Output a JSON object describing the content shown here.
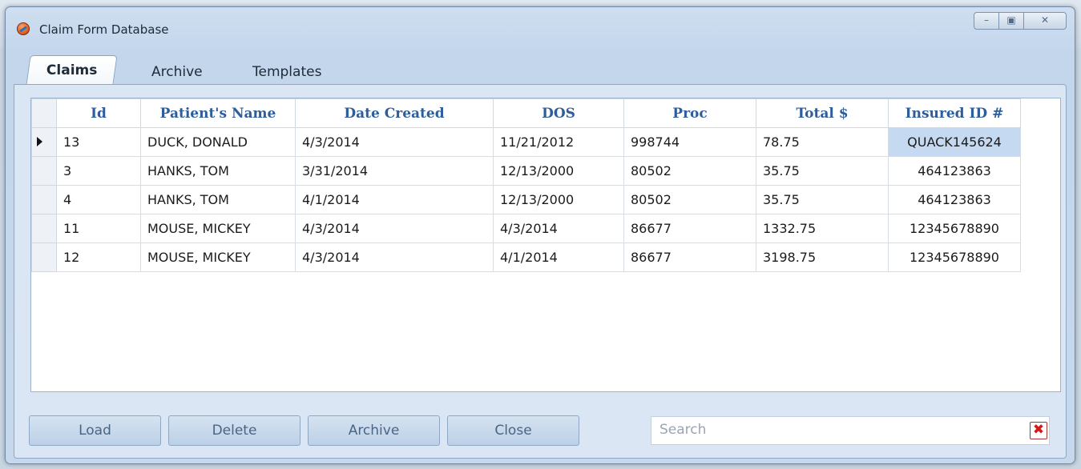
{
  "window": {
    "title": "Claim Form Database"
  },
  "tabs": [
    {
      "label": "Claims",
      "active": true
    },
    {
      "label": "Archive",
      "active": false
    },
    {
      "label": "Templates",
      "active": false
    }
  ],
  "grid": {
    "columns": [
      "Id",
      "Patient's Name",
      "Date Created",
      "DOS",
      "Proc",
      "Total $",
      "Insured ID #"
    ],
    "rows": [
      {
        "id": "13",
        "name": "DUCK, DONALD",
        "created": "4/3/2014",
        "dos": "11/21/2012",
        "proc": "998744",
        "total": "78.75",
        "insured": "QUACK145624"
      },
      {
        "id": "3",
        "name": "HANKS, TOM",
        "created": "3/31/2014",
        "dos": "12/13/2000",
        "proc": "80502",
        "total": "35.75",
        "insured": "464123863"
      },
      {
        "id": "4",
        "name": "HANKS, TOM",
        "created": "4/1/2014",
        "dos": "12/13/2000",
        "proc": "80502",
        "total": "35.75",
        "insured": "464123863"
      },
      {
        "id": "11",
        "name": "MOUSE, MICKEY",
        "created": "4/3/2014",
        "dos": "4/3/2014",
        "proc": "86677",
        "total": "1332.75",
        "insured": "12345678890"
      },
      {
        "id": "12",
        "name": "MOUSE, MICKEY",
        "created": "4/3/2014",
        "dos": "4/1/2014",
        "proc": "86677",
        "total": "3198.75",
        "insured": "12345678890"
      }
    ],
    "selected_row": 0
  },
  "buttons": {
    "load": "Load",
    "delete": "Delete",
    "archive": "Archive",
    "close": "Close"
  },
  "search": {
    "placeholder": "Search",
    "value": ""
  },
  "colors": {
    "header_text": "#2e5d9c",
    "selected_cell": "#c5d9f1",
    "clear_icon": "#d41a1a"
  },
  "icons": {
    "app": "app-logo-icon",
    "minimize": "minimize-icon",
    "maximize": "maximize-icon",
    "close": "close-icon",
    "clear": "clear-search-icon"
  }
}
